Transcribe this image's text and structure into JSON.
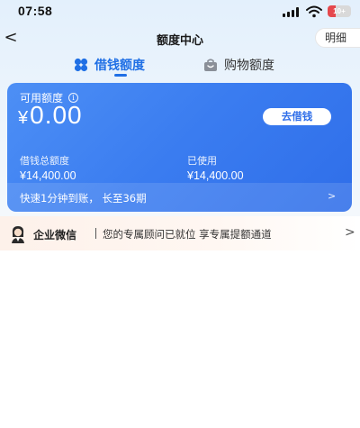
{
  "status_bar": {
    "time": "07:58",
    "battery": "10+"
  },
  "nav": {
    "back_icon": "<",
    "title": "额度中心",
    "detail_label": "明细"
  },
  "tabs": [
    {
      "label": "借钱额度",
      "icon": "clover-grid-icon",
      "active": true
    },
    {
      "label": "购物额度",
      "icon": "shopping-bag-icon",
      "active": false
    }
  ],
  "card": {
    "available_label": "可用额度",
    "currency": "¥",
    "available_value": "0.00",
    "borrow_button": "去借钱",
    "total_label": "借钱总额度",
    "total_value": "¥14,400.00",
    "used_label": "已使用",
    "used_value": "¥14,400.00",
    "footer_text": "快速1分钟到账， 长至36期",
    "footer_arrow": ">"
  },
  "notice": {
    "title": "企业微信",
    "text": "您的专属顾问已就位 享专属提额通道",
    "arrow": ">"
  },
  "colors": {
    "accent": "#1f6fe5",
    "card_blue": "#3a7cf0",
    "battery_red": "#e5484d"
  }
}
